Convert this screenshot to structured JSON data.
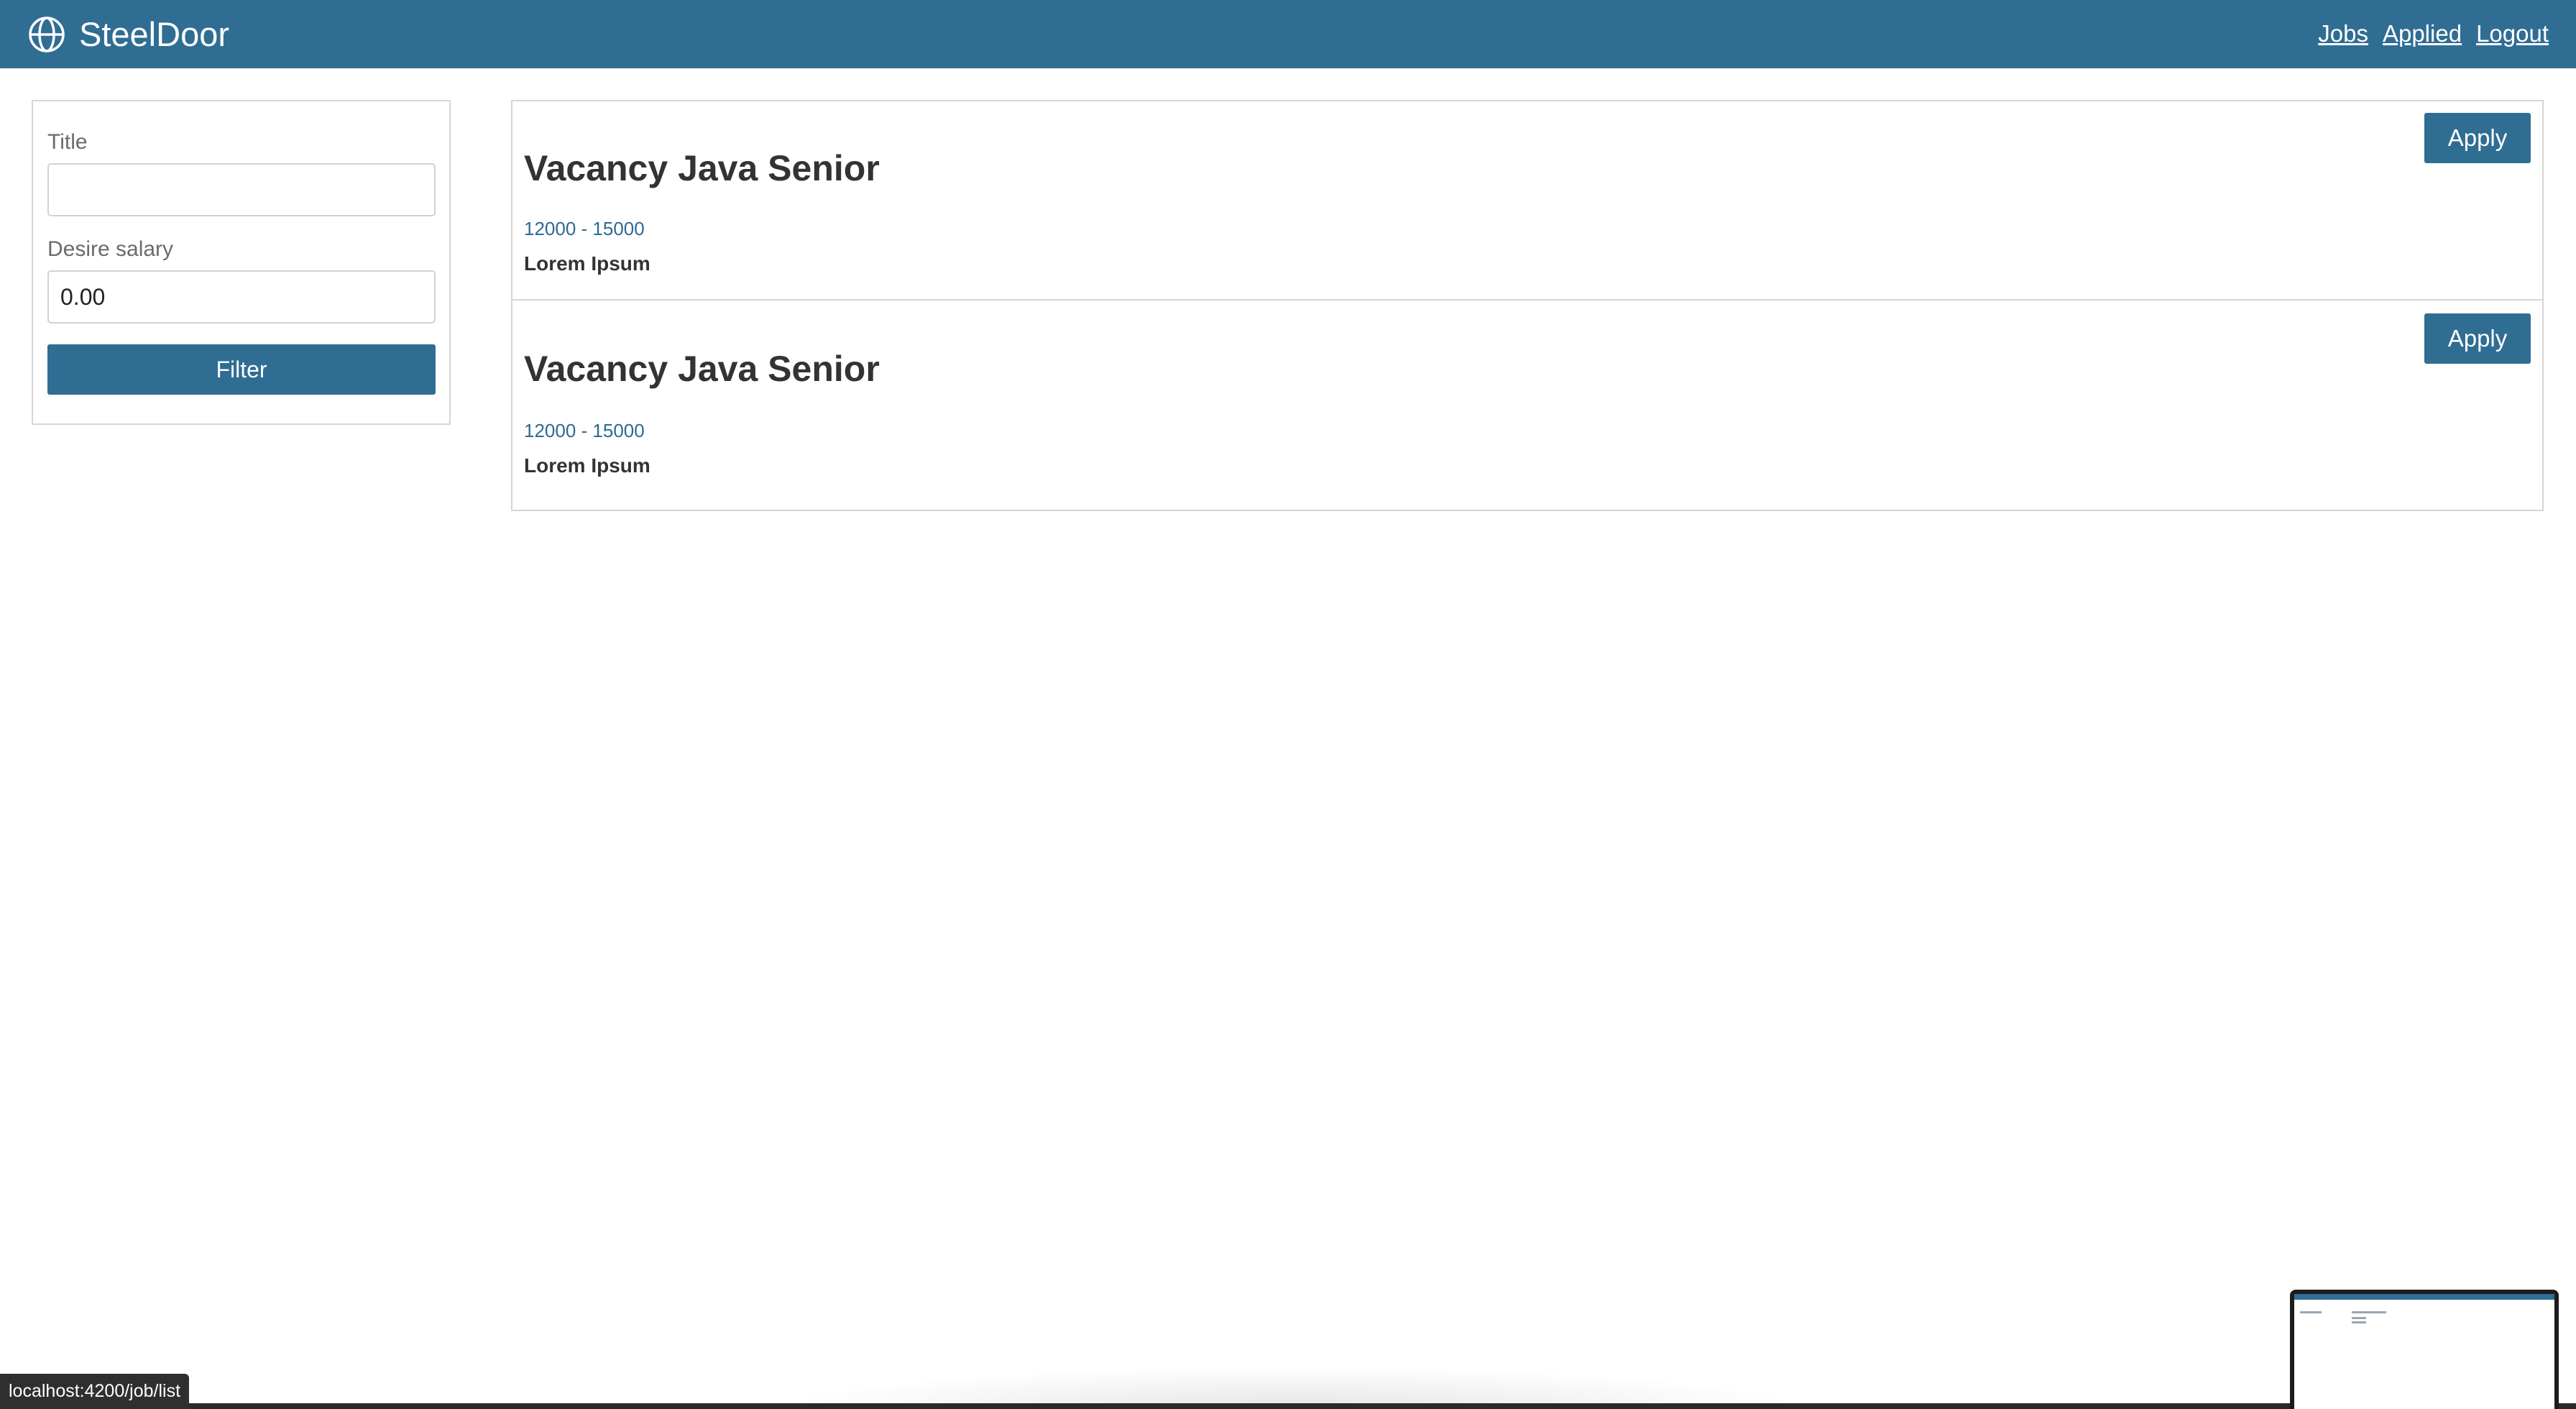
{
  "navbar": {
    "brand": "SteelDoor",
    "links": [
      {
        "label": "Jobs"
      },
      {
        "label": "Applied"
      },
      {
        "label": "Logout"
      }
    ]
  },
  "filter": {
    "title_label": "Title",
    "title_value": "",
    "salary_label": "Desire salary",
    "salary_value": "0.00",
    "button_label": "Filter"
  },
  "jobs": [
    {
      "title": "Vacancy Java Senior",
      "salary": "12000 - 15000",
      "description": "Lorem Ipsum",
      "apply_label": "Apply"
    },
    {
      "title": "Vacancy Java Senior",
      "salary": "12000 - 15000",
      "description": "Lorem Ipsum",
      "apply_label": "Apply"
    }
  ],
  "status_bar": {
    "url": "localhost:4200/job/list"
  },
  "colors": {
    "primary": "#306d93",
    "salary": "#2c6a92",
    "border": "#d5d5d5"
  }
}
